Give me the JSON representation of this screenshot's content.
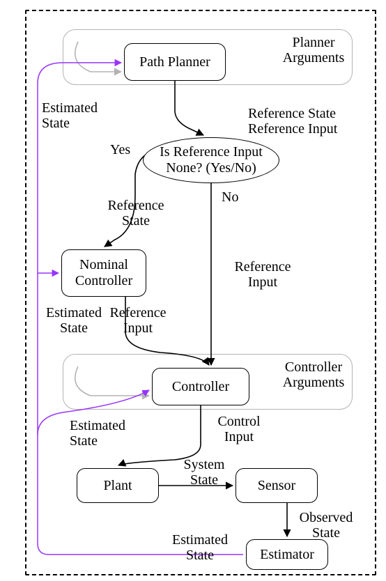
{
  "chart_data": {
    "type": "flowchart",
    "title": "",
    "nodes": [
      {
        "id": "path_planner",
        "type": "process",
        "label": "Path Planner"
      },
      {
        "id": "planner_arguments",
        "type": "args",
        "label": "Planner\nArguments"
      },
      {
        "id": "decision",
        "type": "decision",
        "label": "Is Reference Input\nNone? (Yes/No)"
      },
      {
        "id": "nominal_controller",
        "type": "process",
        "label": "Nominal\nController"
      },
      {
        "id": "controller",
        "type": "process",
        "label": "Controller"
      },
      {
        "id": "controller_arguments",
        "type": "args",
        "label": "Controller\nArguments"
      },
      {
        "id": "plant",
        "type": "process",
        "label": "Plant"
      },
      {
        "id": "sensor",
        "type": "process",
        "label": "Sensor"
      },
      {
        "id": "estimator",
        "type": "process",
        "label": "Estimator"
      }
    ],
    "edges": [
      {
        "from": "planner_arguments",
        "to": "path_planner",
        "label": "",
        "color": "gray"
      },
      {
        "from": "path_planner",
        "to": "decision",
        "label": "Reference State\nReference Input",
        "color": "black"
      },
      {
        "from": "decision",
        "to": "nominal_controller",
        "label": "Yes",
        "side_label": "Reference\nState",
        "color": "black"
      },
      {
        "from": "decision",
        "to": "controller",
        "label": "No",
        "side_label": "Reference\nInput",
        "color": "black"
      },
      {
        "from": "nominal_controller",
        "to": "controller",
        "label": "Reference\nInput",
        "color": "black"
      },
      {
        "from": "controller_arguments",
        "to": "controller",
        "label": "",
        "color": "gray"
      },
      {
        "from": "controller",
        "to": "plant",
        "label": "Control\nInput",
        "color": "black"
      },
      {
        "from": "plant",
        "to": "sensor",
        "label": "System\nState",
        "color": "black"
      },
      {
        "from": "sensor",
        "to": "estimator",
        "label": "Observed\nState",
        "color": "black"
      },
      {
        "from": "estimator",
        "to": "controller",
        "label": "Estimated\nState",
        "color": "purple"
      },
      {
        "from": "estimator",
        "to": "nominal_controller",
        "label": "Estimated\nState",
        "color": "purple"
      },
      {
        "from": "estimator",
        "to": "path_planner",
        "label": "Estimated\nState",
        "color": "purple"
      }
    ],
    "feedback_labels": {
      "to_path_planner": "Estimated\nState",
      "to_nominal_controller": "Estimated\nState",
      "from_nominal_controller_left": "Estimated\nState",
      "to_controller": "Estimated\nState",
      "from_estimator_bottom": "Estimated\nState"
    }
  }
}
